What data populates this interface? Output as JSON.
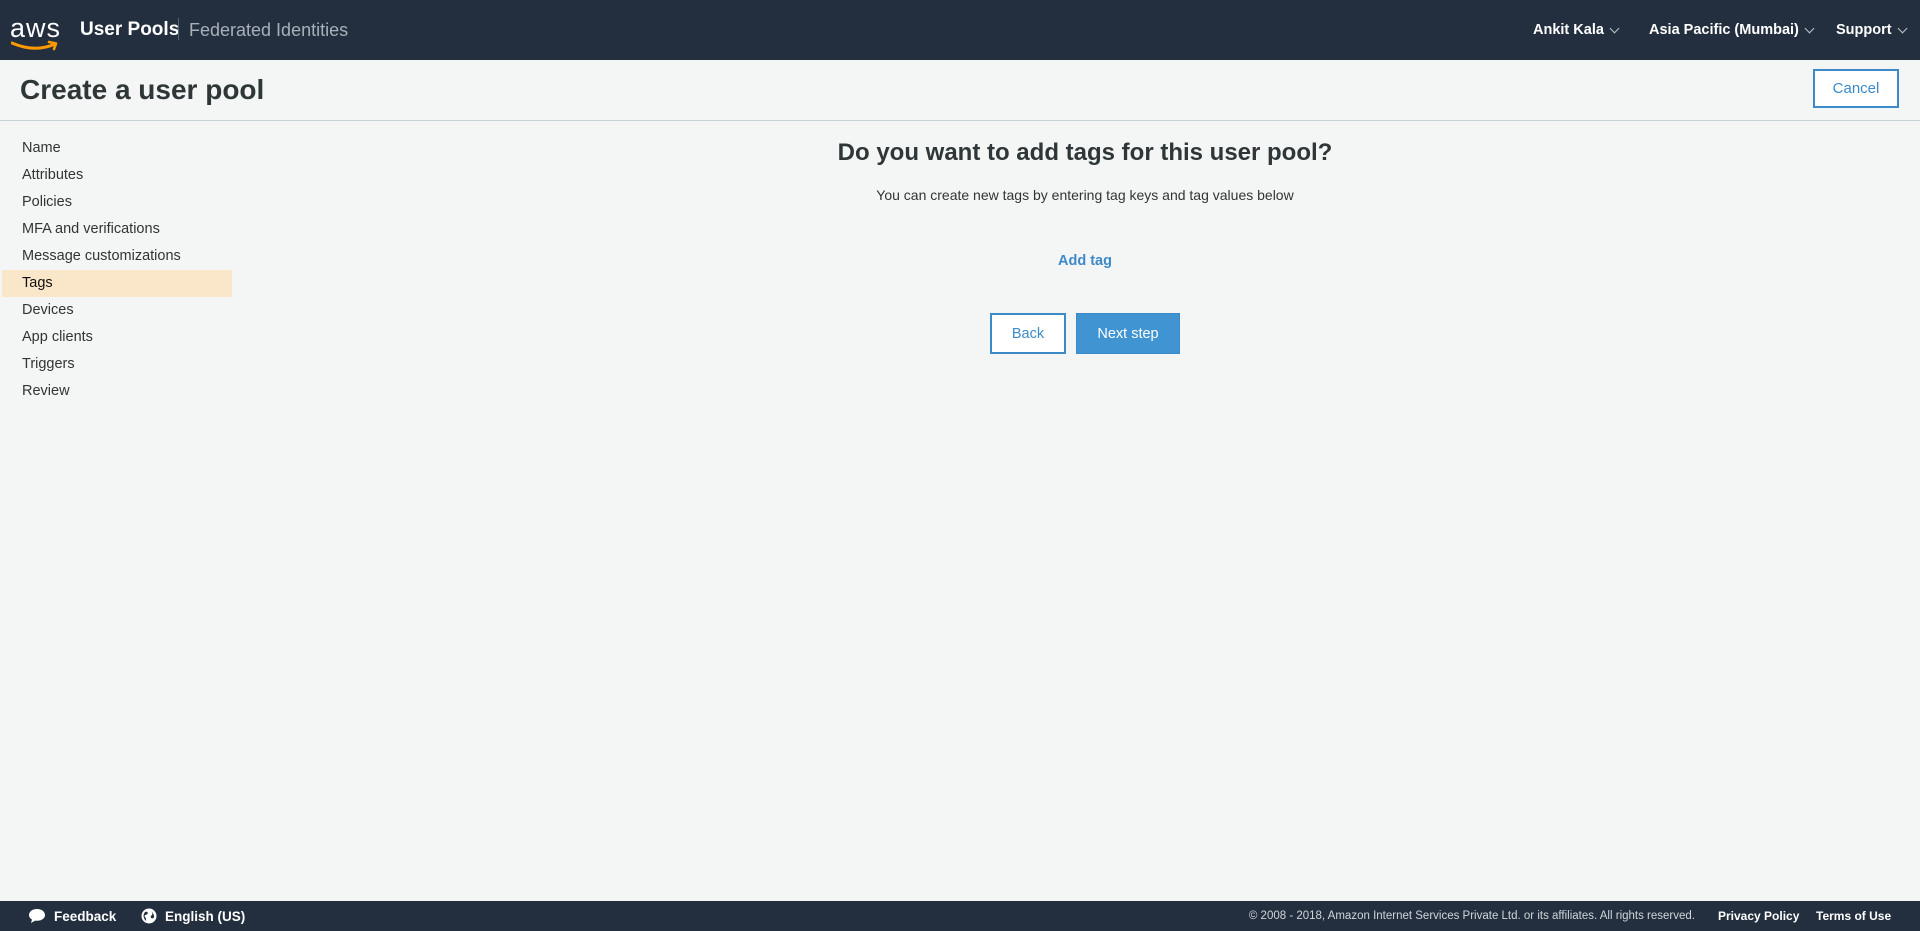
{
  "nav": {
    "logo_text": "aws",
    "title": "User Pools",
    "federated": "Federated Identities",
    "user": "Ankit Kala",
    "region": "Asia Pacific (Mumbai)",
    "support": "Support"
  },
  "header": {
    "title": "Create a user pool",
    "cancel_label": "Cancel"
  },
  "sidebar": {
    "items": [
      {
        "label": "Name"
      },
      {
        "label": "Attributes"
      },
      {
        "label": "Policies"
      },
      {
        "label": "MFA and verifications"
      },
      {
        "label": "Message customizations"
      },
      {
        "label": "Tags"
      },
      {
        "label": "Devices"
      },
      {
        "label": "App clients"
      },
      {
        "label": "Triggers"
      },
      {
        "label": "Review"
      }
    ],
    "active": "Tags"
  },
  "main": {
    "heading": "Do you want to add tags for this user pool?",
    "subtitle": "You can create new tags by entering tag keys and tag values below",
    "add_tag": "Add tag",
    "back_label": "Back",
    "next_label": "Next step"
  },
  "footer": {
    "feedback": "Feedback",
    "language": "English (US)",
    "copyright": "© 2008 - 2018, Amazon Internet Services Private Ltd. or its affiliates. All rights reserved.",
    "privacy": "Privacy Policy",
    "terms": "Terms of Use"
  },
  "colors": {
    "nav_bg": "#232f3e",
    "accent": "#3d8ac9",
    "active_item_bg": "#fae6c8",
    "logo_smile": "#ff9900"
  }
}
